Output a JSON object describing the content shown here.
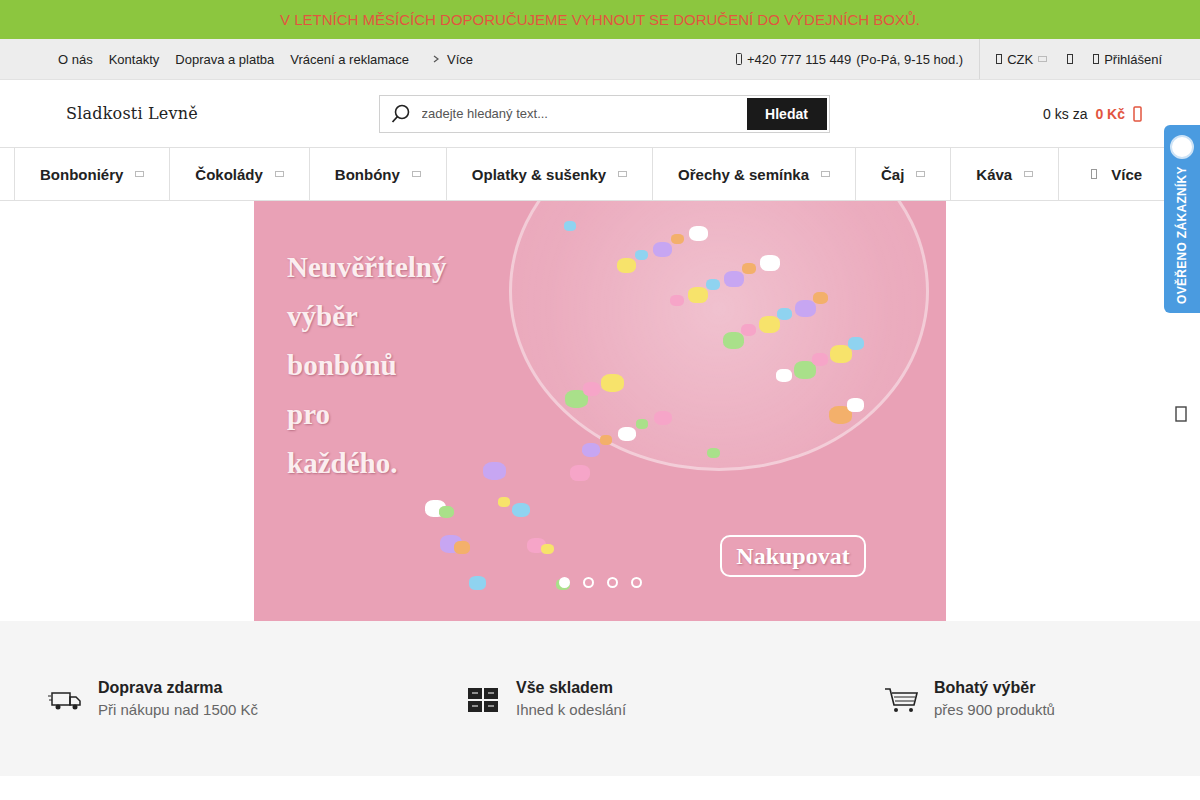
{
  "announcement": "V LETNÍCH MĚSÍCÍCH DOPORUČUJEME VYHNOUT SE DORUČENÍ DO VÝDEJNÍCH BOXŮ.",
  "top_links": [
    "O nás",
    "Kontakty",
    "Doprava a platba",
    "Vrácení a reklamace"
  ],
  "top_more": "Více",
  "phone": "+420 777 115 449",
  "hours": "(Po-Pá, 9-15 hod.)",
  "currency": "CZK",
  "login": "Přihlášení",
  "logo": "Sladkosti Levně",
  "search": {
    "placeholder": "zadejte hledaný text...",
    "button": "Hledat"
  },
  "cart": {
    "count": "0 ks za",
    "total": "0 Kč"
  },
  "nav": [
    "Bonboniéry",
    "Čokolády",
    "Bonbóny",
    "Oplatky & sušenky",
    "Ořechy & semínka",
    "Čaj",
    "Káva"
  ],
  "nav_more": "Více",
  "badge": "OVĚŘENO ZÁKAZNÍKY",
  "banner": {
    "lines": [
      "Neuvěřitelný",
      "výběr",
      "bonbónů",
      "pro",
      "každého."
    ],
    "button": "Nakupovat",
    "dots": [
      {
        "selected": true
      },
      {
        "selected": false
      },
      {
        "selected": false
      },
      {
        "selected": false
      }
    ]
  },
  "features": [
    {
      "title": "Doprava zdarma",
      "subtitle": "Při nákupu nad 1500 Kč"
    },
    {
      "title": "Vše skladem",
      "subtitle": "Ihned k odeslání"
    },
    {
      "title": "Bohatý výběr",
      "subtitle": "přes 900 produktů"
    }
  ]
}
